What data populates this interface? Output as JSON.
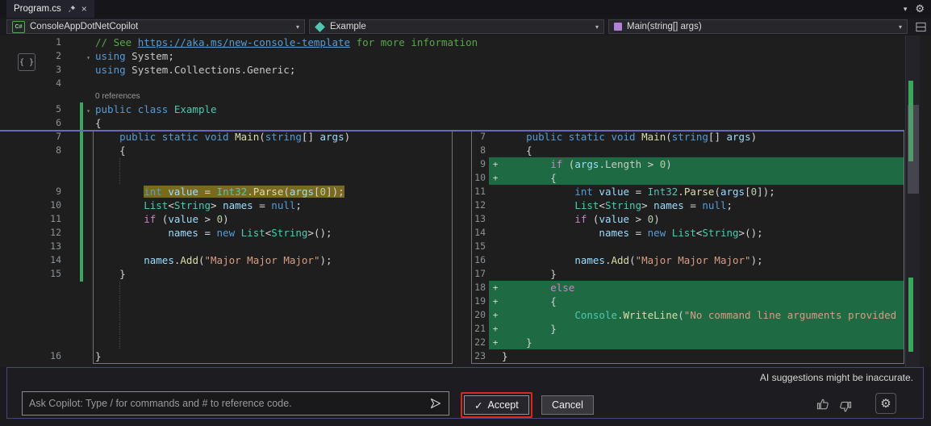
{
  "window": {
    "tab_title": "Program.cs"
  },
  "navbar": {
    "project_label": "ConsoleAppDotNetCopilot",
    "type_label": "Example",
    "member_label": "Main(string[] args)"
  },
  "icons": {
    "close": "×",
    "chevron_down": "▾",
    "gear": "⚙",
    "check": "✓",
    "fold_chevron": "▾",
    "plus_marker": "+",
    "code_braces": "{ }",
    "csharp_project": "C#",
    "send": "paper-plane-right",
    "pin": "pushpin",
    "thumbs_up": "thumb-up-outline",
    "thumbs_down": "thumb-down-outline"
  },
  "colors": {
    "added_line_bg": "#1e6a42",
    "changed_line_bg": "#7a6a21",
    "accent_border": "#6a66c4",
    "annotation_red": "#e0251b",
    "change_bar_green": "#39a85c"
  },
  "editor": {
    "codelens_label": "0 references",
    "top_lines": [
      {
        "n": "1",
        "tokens": [
          [
            "cm",
            "// See "
          ],
          [
            "link",
            "https://aka.ms/new-console-template"
          ],
          [
            "cm",
            " for more information"
          ]
        ]
      },
      {
        "n": "2",
        "fold": true,
        "tokens": [
          [
            "kw",
            "using"
          ],
          [
            "txt",
            " System"
          ],
          [
            "pn",
            ";"
          ]
        ]
      },
      {
        "n": "3",
        "tokens": [
          [
            "kw",
            "using"
          ],
          [
            "txt",
            " System.Collections.Generic"
          ],
          [
            "pn",
            ";"
          ]
        ]
      },
      {
        "n": "4",
        "tokens": []
      },
      {
        "codelens": true
      },
      {
        "n": "5",
        "fold": true,
        "tokens": [
          [
            "kw",
            "public"
          ],
          [
            "txt",
            " "
          ],
          [
            "kw",
            "class"
          ],
          [
            "txt",
            " "
          ],
          [
            "type",
            "Example"
          ]
        ]
      },
      {
        "n": "6",
        "tokens": [
          [
            "pn",
            "{"
          ]
        ]
      }
    ],
    "diff": {
      "left_lines": [
        {
          "n": "7",
          "tokens": [
            [
              "pn",
              "    "
            ],
            [
              "kw",
              "public"
            ],
            [
              "txt",
              " "
            ],
            [
              "kw",
              "static"
            ],
            [
              "txt",
              " "
            ],
            [
              "kw",
              "void"
            ],
            [
              "txt",
              " "
            ],
            [
              "method",
              "Main"
            ],
            [
              "pn",
              "("
            ],
            [
              "kw",
              "string"
            ],
            [
              "pn",
              "[] "
            ],
            [
              "var",
              "args"
            ],
            [
              "pn",
              ")"
            ]
          ]
        },
        {
          "n": "8",
          "tokens": [
            [
              "pn",
              "    {"
            ]
          ]
        },
        {
          "fill": true
        },
        {
          "fill": true
        },
        {
          "n": "9",
          "mod": true,
          "pre": "        ",
          "tokens": [
            [
              "kw",
              "int"
            ],
            [
              "txt",
              " "
            ],
            [
              "var",
              "value"
            ],
            [
              "pn",
              " = "
            ],
            [
              "type",
              "Int32"
            ],
            [
              "pn",
              "."
            ],
            [
              "method",
              "Parse"
            ],
            [
              "pn",
              "("
            ],
            [
              "var",
              "args"
            ],
            [
              "pn",
              "["
            ],
            [
              "num",
              "0"
            ],
            [
              "pn",
              "]);"
            ]
          ]
        },
        {
          "n": "10",
          "tokens": [
            [
              "pn",
              "        "
            ],
            [
              "type",
              "List"
            ],
            [
              "pn",
              "<"
            ],
            [
              "type",
              "String"
            ],
            [
              "pn",
              "> "
            ],
            [
              "var",
              "names"
            ],
            [
              "pn",
              " = "
            ],
            [
              "kw sq",
              "null"
            ],
            [
              "pn",
              ";"
            ]
          ]
        },
        {
          "n": "11",
          "tokens": [
            [
              "pn",
              "        "
            ],
            [
              "ctl",
              "if"
            ],
            [
              "pn",
              " ("
            ],
            [
              "var",
              "value"
            ],
            [
              "pn",
              " > "
            ],
            [
              "num",
              "0"
            ],
            [
              "pn",
              ")"
            ]
          ]
        },
        {
          "n": "12",
          "tokens": [
            [
              "pn",
              "            "
            ],
            [
              "var",
              "names"
            ],
            [
              "pn",
              " = "
            ],
            [
              "kw",
              "new"
            ],
            [
              "txt",
              " "
            ],
            [
              "type",
              "List"
            ],
            [
              "pn",
              "<"
            ],
            [
              "type",
              "String"
            ],
            [
              "pn",
              ">();"
            ]
          ]
        },
        {
          "n": "13",
          "tokens": []
        },
        {
          "n": "14",
          "tokens": [
            [
              "pn",
              "        "
            ],
            [
              "var sq",
              "names"
            ],
            [
              "pn",
              "."
            ],
            [
              "method sq",
              "Add"
            ],
            [
              "pn",
              "("
            ],
            [
              "str",
              "\"Major Major Major\""
            ],
            [
              "pn",
              ");"
            ]
          ]
        },
        {
          "n": "15",
          "tokens": [
            [
              "pn",
              "    }"
            ]
          ]
        },
        {
          "fill": true
        },
        {
          "fill": true
        },
        {
          "fill": true
        },
        {
          "fill": true
        },
        {
          "fill": true
        },
        {
          "n": "16",
          "tokens": [
            [
              "pn",
              "}"
            ]
          ]
        }
      ],
      "right_lines": [
        {
          "n": "7",
          "tokens": [
            [
              "pn",
              "    "
            ],
            [
              "kw",
              "public"
            ],
            [
              "txt",
              " "
            ],
            [
              "kw",
              "static"
            ],
            [
              "txt",
              " "
            ],
            [
              "kw",
              "void"
            ],
            [
              "txt",
              " "
            ],
            [
              "method",
              "Main"
            ],
            [
              "pn",
              "("
            ],
            [
              "kw",
              "string"
            ],
            [
              "pn",
              "[] "
            ],
            [
              "var",
              "args"
            ],
            [
              "pn",
              ")"
            ]
          ]
        },
        {
          "n": "8",
          "tokens": [
            [
              "pn",
              "    {"
            ]
          ]
        },
        {
          "n": "9",
          "add": true,
          "tokens": [
            [
              "pn",
              "        "
            ],
            [
              "ctl",
              "if"
            ],
            [
              "pn",
              " ("
            ],
            [
              "var",
              "args"
            ],
            [
              "pn",
              "."
            ],
            [
              "txt",
              "Length"
            ],
            [
              "pn",
              " > "
            ],
            [
              "num",
              "0"
            ],
            [
              "pn",
              ")"
            ]
          ]
        },
        {
          "n": "10",
          "add": true,
          "tokens": [
            [
              "pn",
              "        {"
            ]
          ]
        },
        {
          "n": "11",
          "tokens": [
            [
              "pn",
              "            "
            ],
            [
              "kw",
              "int"
            ],
            [
              "txt",
              " "
            ],
            [
              "var",
              "value"
            ],
            [
              "pn",
              " = "
            ],
            [
              "type",
              "Int32"
            ],
            [
              "pn",
              "."
            ],
            [
              "method",
              "Parse"
            ],
            [
              "pn",
              "("
            ],
            [
              "var",
              "args"
            ],
            [
              "pn",
              "["
            ],
            [
              "num",
              "0"
            ],
            [
              "pn",
              "]);"
            ]
          ]
        },
        {
          "n": "12",
          "tokens": [
            [
              "pn",
              "            "
            ],
            [
              "type",
              "List"
            ],
            [
              "pn",
              "<"
            ],
            [
              "type",
              "String"
            ],
            [
              "pn",
              "> "
            ],
            [
              "var",
              "names"
            ],
            [
              "pn",
              " = "
            ],
            [
              "kw",
              "null"
            ],
            [
              "pn",
              ";"
            ]
          ]
        },
        {
          "n": "13",
          "tokens": [
            [
              "pn",
              "            "
            ],
            [
              "ctl",
              "if"
            ],
            [
              "pn",
              " ("
            ],
            [
              "var",
              "value"
            ],
            [
              "pn",
              " > "
            ],
            [
              "num",
              "0"
            ],
            [
              "pn",
              ")"
            ]
          ]
        },
        {
          "n": "14",
          "tokens": [
            [
              "pn",
              "                "
            ],
            [
              "var",
              "names"
            ],
            [
              "pn",
              " = "
            ],
            [
              "kw",
              "new"
            ],
            [
              "txt",
              " "
            ],
            [
              "type",
              "List"
            ],
            [
              "pn",
              "<"
            ],
            [
              "type",
              "String"
            ],
            [
              "pn",
              ">();"
            ]
          ]
        },
        {
          "n": "15",
          "tokens": []
        },
        {
          "n": "16",
          "tokens": [
            [
              "pn",
              "            "
            ],
            [
              "var",
              "names"
            ],
            [
              "pn",
              "."
            ],
            [
              "method",
              "Add"
            ],
            [
              "pn",
              "("
            ],
            [
              "str",
              "\"Major Major Major\""
            ],
            [
              "pn",
              ");"
            ]
          ]
        },
        {
          "n": "17",
          "tokens": [
            [
              "pn",
              "        }"
            ]
          ]
        },
        {
          "n": "18",
          "add": true,
          "tokens": [
            [
              "pn",
              "        "
            ],
            [
              "ctl",
              "else"
            ]
          ]
        },
        {
          "n": "19",
          "add": true,
          "tokens": [
            [
              "pn",
              "        {"
            ]
          ]
        },
        {
          "n": "20",
          "add": true,
          "tokens": [
            [
              "pn",
              "            "
            ],
            [
              "type",
              "Console"
            ],
            [
              "pn",
              "."
            ],
            [
              "method",
              "WriteLine"
            ],
            [
              "pn",
              "("
            ],
            [
              "str",
              "\"No command line arguments provided"
            ]
          ]
        },
        {
          "n": "21",
          "add": true,
          "tokens": [
            [
              "pn",
              "        }"
            ]
          ]
        },
        {
          "n": "22",
          "add": true,
          "tokens": [
            [
              "pn",
              "    }"
            ]
          ]
        },
        {
          "n": "23",
          "tokens": [
            [
              "pn",
              "}"
            ]
          ]
        }
      ]
    }
  },
  "copilot_panel": {
    "disclaimer": "AI suggestions might be inaccurate.",
    "input_placeholder": "Ask Copilot: Type / for commands and # to reference code.",
    "accept_label": "Accept",
    "cancel_label": "Cancel"
  }
}
